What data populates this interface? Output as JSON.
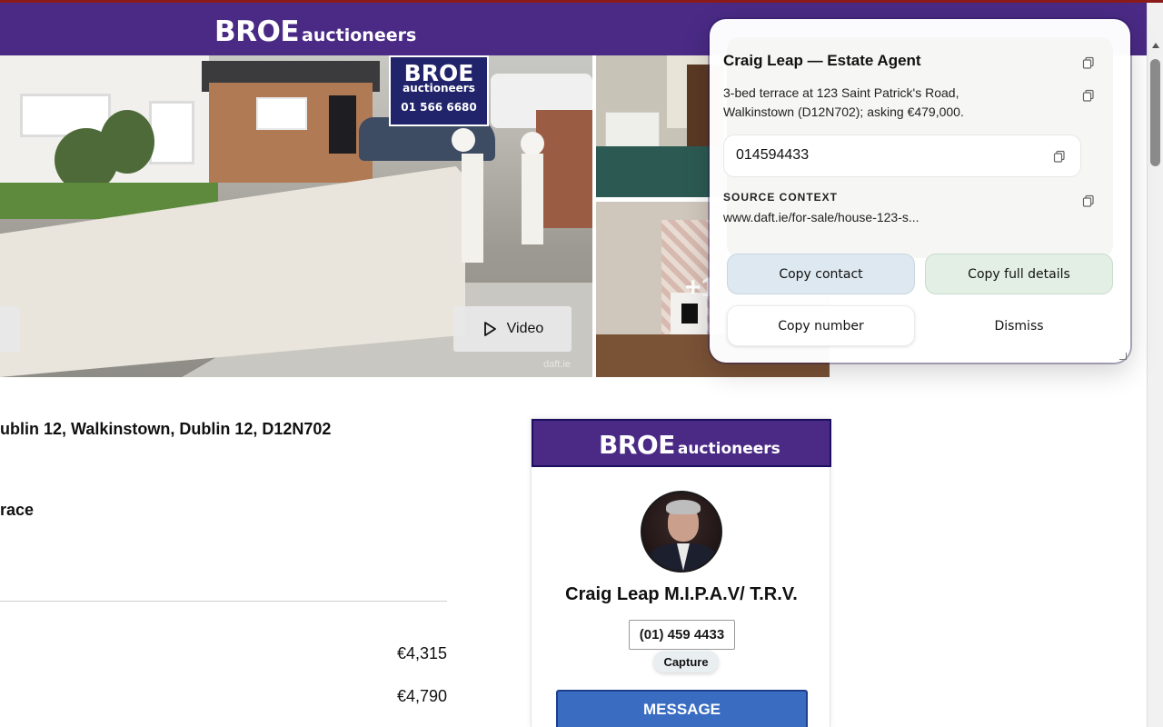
{
  "header": {
    "brand": "BROE",
    "brand_sub": "auctioneers"
  },
  "gallery": {
    "sign": {
      "brand": "BROE",
      "sub": "auctioneers",
      "phone": "01 566 6680"
    },
    "video_label": "Video",
    "watermark": "daft.ie",
    "more_count": "+1"
  },
  "listing": {
    "address": "ublin 12, Walkinstown, Dublin 12, D12N702",
    "property_type": "race",
    "prices": [
      "€4,315",
      "€4,790"
    ]
  },
  "agent_card": {
    "brand": "BROE",
    "brand_sub": "auctioneers",
    "name": "Craig Leap M.I.P.A.V/ T.R.V.",
    "phone": "(01) 459 4433",
    "capture_label": "Capture",
    "message_label": "MESSAGE"
  },
  "popup": {
    "title": "Craig Leap — Estate Agent",
    "description": "3-bed terrace at 123 Saint Patrick's Road, Walkinstown (D12N702); asking €479,000.",
    "phone": "014594433",
    "source_label": "SOURCE CONTEXT",
    "source_url": "www.daft.ie/for-sale/house-123-s...",
    "buttons": {
      "copy_contact": "Copy contact",
      "copy_full": "Copy full details",
      "copy_number": "Copy number",
      "dismiss": "Dismiss"
    }
  },
  "colors": {
    "brand_purple": "#4a2a85",
    "message_blue": "#3a6cc2",
    "copy_contact_bg": "#dde8f0",
    "copy_full_bg": "#e3efe4"
  },
  "icons": [
    "play-icon",
    "copy-icon"
  ]
}
